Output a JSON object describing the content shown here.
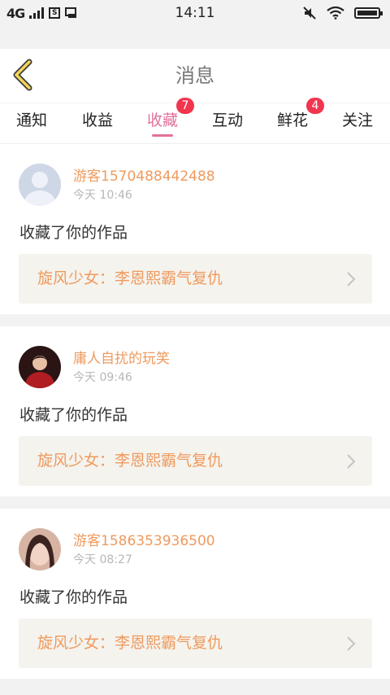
{
  "status_bar": {
    "network": "4G",
    "sim_icon_text": "S",
    "time": "14:11"
  },
  "header": {
    "title": "消息",
    "back_icon": "chevron-left-icon"
  },
  "tabs": [
    {
      "label": "通知",
      "active": false,
      "badge": ""
    },
    {
      "label": "收益",
      "active": false,
      "badge": ""
    },
    {
      "label": "收藏",
      "active": true,
      "badge": "7"
    },
    {
      "label": "互动",
      "active": false,
      "badge": ""
    },
    {
      "label": "鲜花",
      "active": false,
      "badge": "4"
    },
    {
      "label": "关注",
      "active": false,
      "badge": ""
    }
  ],
  "messages": [
    {
      "username": "游客1570488442488",
      "time": "今天 10:46",
      "action": "收藏了你的作品",
      "work_title": "旋风少女：李恩熙霸气复仇",
      "avatar": "default-avatar"
    },
    {
      "username": "庸人自扰的玩笑",
      "time": "今天 09:46",
      "action": "收藏了你的作品",
      "work_title": "旋风少女：李恩熙霸气复仇",
      "avatar": "photo-avatar-red"
    },
    {
      "username": "游客1586353936500",
      "time": "今天 08:27",
      "action": "收藏了你的作品",
      "work_title": "旋风少女：李恩熙霸气复仇",
      "avatar": "photo-avatar-girl"
    }
  ],
  "colors": {
    "accent_pink": "#e2709b",
    "badge_red": "#f2354f",
    "username_orange": "#ef9a5e",
    "back_icon_yellow": "#f2d558"
  }
}
